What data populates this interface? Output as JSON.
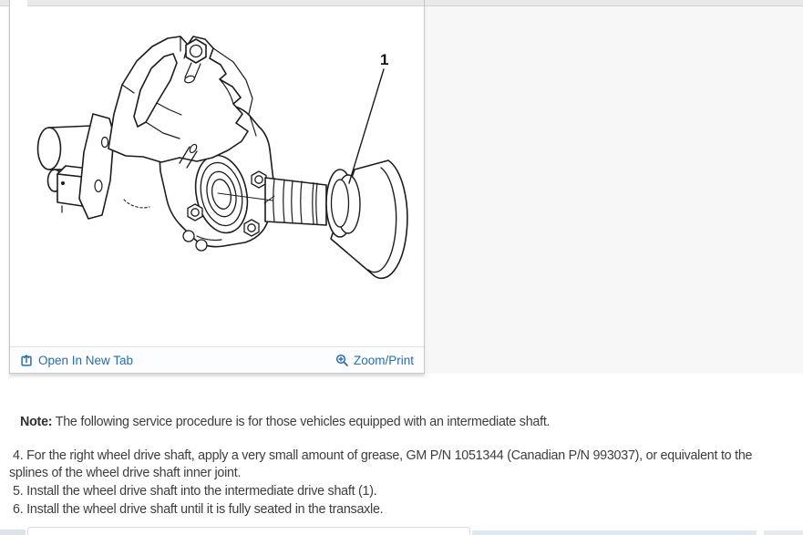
{
  "figure": {
    "callout": "1",
    "toolbar": {
      "open_in_new_tab": "Open In New Tab",
      "zoom_print": "Zoom/Print"
    }
  },
  "content": {
    "note_label": "Note:",
    "note_text": " The following service procedure is for those vehicles equipped with an intermediate shaft.",
    "steps": [
      "4. For the right wheel drive shaft, apply a very small amount of grease, GM P/N 1051344 (Canadian P/N 993037), or equivalent to the splines of the wheel drive shaft inner joint.",
      "5. Install the wheel drive shaft into the intermediate drive shaft (1).",
      "6. Install the wheel drive shaft until it is fully seated in the transaxle."
    ]
  },
  "colors": {
    "link": "#2a6cad",
    "text": "#3d3d3d"
  }
}
